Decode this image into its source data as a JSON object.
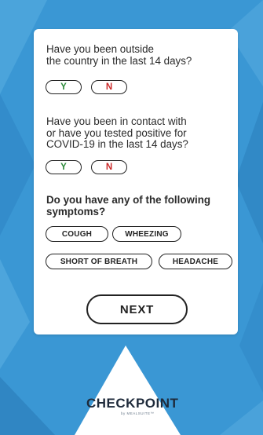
{
  "questions": {
    "q1": {
      "line1": "Have you been outside",
      "line2": "the country in the last 14 days?"
    },
    "q2": {
      "line1": "Have you been in contact with",
      "line2": "or have you tested positive for",
      "line3": "COVID-19 in the last 14 days?"
    },
    "q3": {
      "line1": "Do you have any of the following",
      "line2": "symptoms?"
    }
  },
  "answers": {
    "yes": "Y",
    "no": "N"
  },
  "symptoms": [
    "COUGH",
    "WHEEZING",
    "SHORT OF BREATH",
    "HEADACHE"
  ],
  "next_label": "NEXT",
  "brand": {
    "name": "CHECKPOINT",
    "sub": "by MEALSUITE™"
  },
  "colors": {
    "background": "#3a97d4",
    "yes": "#2d8a3a",
    "no": "#cc2a2a"
  }
}
